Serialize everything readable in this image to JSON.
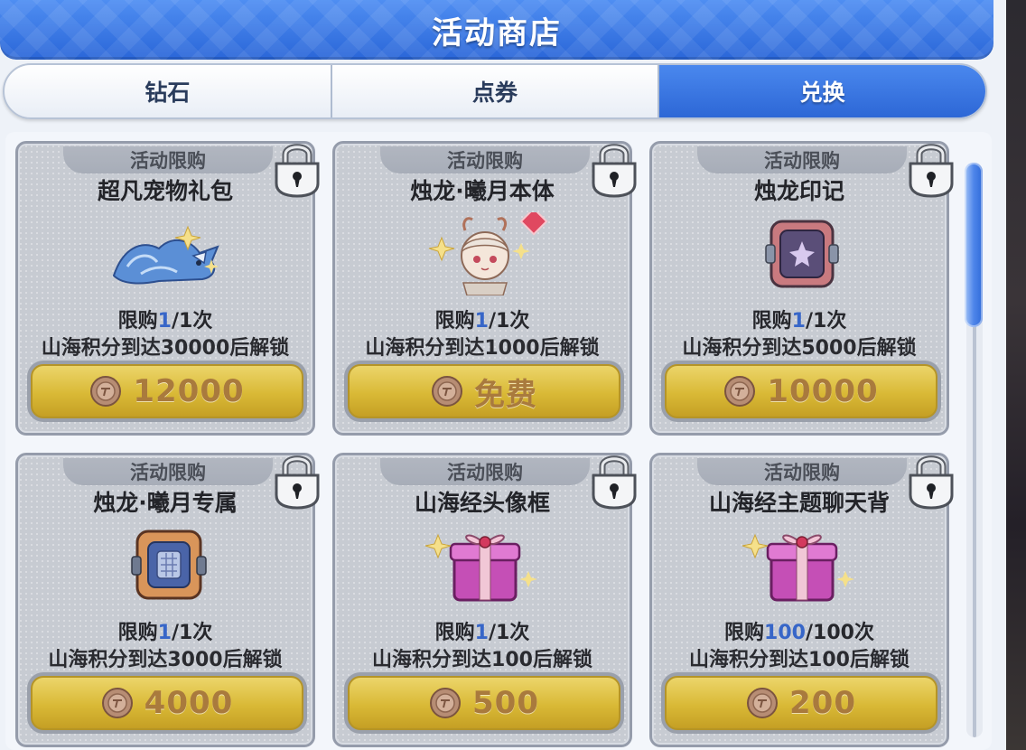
{
  "header": {
    "title": "活动商店"
  },
  "tabs": [
    {
      "label": "钻石",
      "active": false
    },
    {
      "label": "点券",
      "active": false
    },
    {
      "label": "兑换",
      "active": true
    }
  ],
  "items": [
    {
      "tag": "活动限购",
      "name": "超凡宠物礼包",
      "limit_prefix": "限购",
      "limit_used": "1",
      "limit_total": "/1次",
      "unlock": "山海积分到达30000后解锁",
      "price": "12000",
      "art": "spirit-beast",
      "locked": true
    },
    {
      "tag": "活动限购",
      "name": "烛龙·曦月本体",
      "limit_prefix": "限购",
      "limit_used": "1",
      "limit_total": "/1次",
      "unlock": "山海积分到达1000后解锁",
      "price": "免费",
      "art": "character-portrait",
      "locked": true
    },
    {
      "tag": "活动限购",
      "name": "烛龙印记",
      "limit_prefix": "限购",
      "limit_used": "1",
      "limit_total": "/1次",
      "unlock": "山海积分到达5000后解锁",
      "price": "10000",
      "art": "seal-box",
      "locked": true
    },
    {
      "tag": "活动限购",
      "name": "烛龙·曦月专属",
      "limit_prefix": "限购",
      "limit_used": "1",
      "limit_total": "/1次",
      "unlock": "山海积分到达3000后解锁",
      "price": "4000",
      "art": "rune-box",
      "locked": true
    },
    {
      "tag": "活动限购",
      "name": "山海经头像框",
      "limit_prefix": "限购",
      "limit_used": "1",
      "limit_total": "/1次",
      "unlock": "山海积分到达100后解锁",
      "price": "500",
      "art": "gift-box",
      "locked": true
    },
    {
      "tag": "活动限购",
      "name": "山海经主题聊天背",
      "limit_prefix": "限购",
      "limit_used": "100",
      "limit_total": "/100次",
      "unlock": "山海积分到达100后解锁",
      "price": "200",
      "art": "gift-box",
      "locked": true
    }
  ],
  "colors": {
    "header_blue": "#2f6ad9",
    "price_gold": "#d9b936",
    "limit_number_blue": "#3766c8"
  },
  "icons": {
    "currency": "coin-icon",
    "lock": "lock-icon"
  }
}
